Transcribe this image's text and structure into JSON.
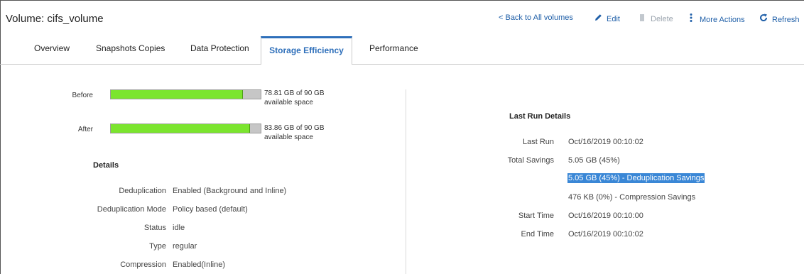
{
  "header": {
    "title": "Volume: cifs_volume",
    "back_link": "< Back to All volumes",
    "edit_label": "Edit",
    "delete_label": "Delete",
    "more_actions_label": "More Actions",
    "refresh_label": "Refresh"
  },
  "tabs": [
    {
      "label": "Overview"
    },
    {
      "label": "Snapshots Copies"
    },
    {
      "label": "Data Protection"
    },
    {
      "label": "Storage Efficiency",
      "active": true
    },
    {
      "label": "Performance"
    }
  ],
  "space": {
    "before": {
      "label": "Before",
      "used_fraction": 0.88,
      "line1": "78.81 GB of 90 GB",
      "line2": "available space"
    },
    "after": {
      "label": "After",
      "used_fraction": 0.93,
      "line1": "83.86 GB of 90 GB",
      "line2": "available space"
    }
  },
  "details": {
    "heading": "Details",
    "rows": [
      {
        "label": "Deduplication",
        "value": "Enabled (Background and Inline)"
      },
      {
        "label": "Deduplication Mode",
        "value": "Policy based (default)"
      },
      {
        "label": "Status",
        "value": "idle"
      },
      {
        "label": "Type",
        "value": "regular"
      },
      {
        "label": "Compression",
        "value": "Enabled(Inline)"
      }
    ]
  },
  "last_run": {
    "heading": "Last Run Details",
    "last_run_label": "Last Run",
    "last_run_value": "Oct/16/2019 00:10:02",
    "total_savings_label": "Total Savings",
    "total_savings_value": "5.05 GB (45%)",
    "dedup_savings": "5.05 GB (45%) - Deduplication Savings",
    "compression_savings": "476 KB (0%) - Compression Savings",
    "start_time_label": "Start Time",
    "start_time_value": "Oct/16/2019 00:10:00",
    "end_time_label": "End Time",
    "end_time_value": "Oct/16/2019 00:10:02"
  },
  "colors": {
    "accent": "#2e6fba",
    "bar_fill": "#7be52e",
    "bar_empty": "#c6c6c6",
    "highlight": "#3a87d6"
  },
  "icons": {
    "edit": "pencil-icon",
    "delete": "trash-icon",
    "more": "vertical-dots-icon",
    "refresh": "refresh-icon"
  }
}
